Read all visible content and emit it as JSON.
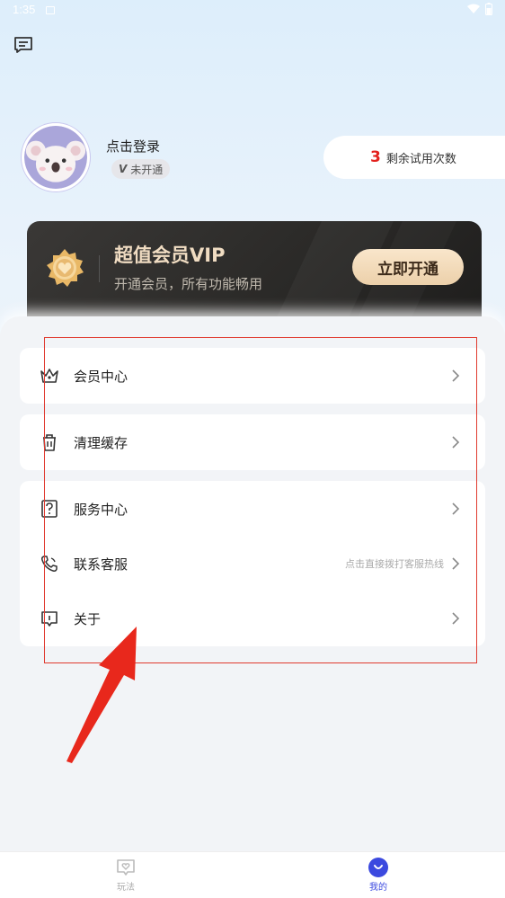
{
  "status_bar": {
    "time": "1:35"
  },
  "profile": {
    "login_text": "点击登录",
    "vip_badge_letter": "V",
    "vip_badge_text": "未开通",
    "trial_count": "3",
    "trial_label": "剩余试用次数"
  },
  "vip_card": {
    "title": "超值会员VIP",
    "subtitle": "开通会员，所有功能畅用",
    "button": "立即开通"
  },
  "menu": {
    "member_center": "会员中心",
    "clear_cache": "清理缓存",
    "service_center": "服务中心",
    "contact_service": "联系客服",
    "contact_hint": "点击直接拨打客服热线",
    "about": "关于"
  },
  "tabbar": {
    "play": "玩法",
    "mine": "我的"
  },
  "colors": {
    "accent_blue": "#3b49df",
    "trial_red": "#e3211d",
    "vip_gold": "#f0dcc2",
    "annotation_red": "#e03a2f"
  }
}
